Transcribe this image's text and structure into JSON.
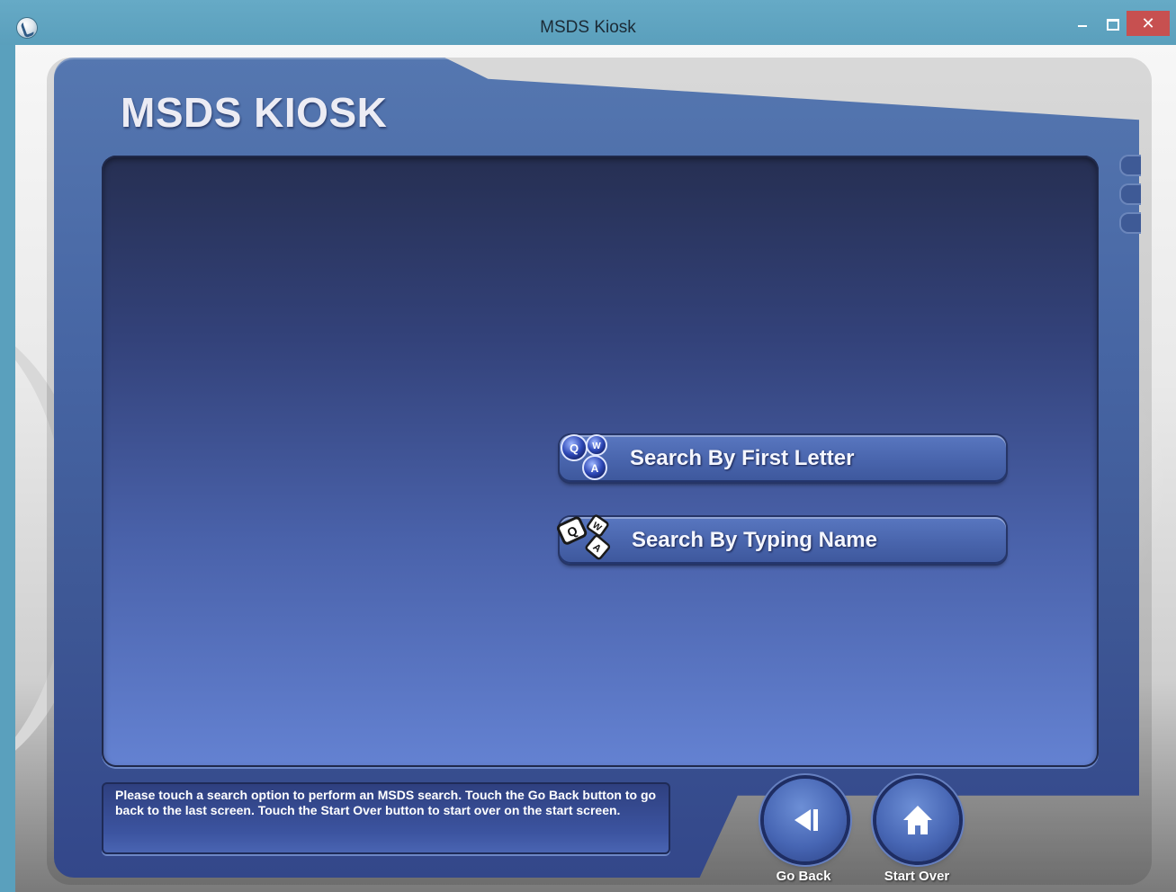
{
  "window": {
    "title": "MSDS Kiosk",
    "close_glyph": "✕"
  },
  "header": {
    "title": "MSDS KIOSK"
  },
  "search_options": [
    {
      "label": "Search By First Letter",
      "icon": "qwa-round-keys-icon"
    },
    {
      "label": "Search By Typing Name",
      "icon": "qwa-square-keys-icon"
    }
  ],
  "help": {
    "text": "Please touch a search option to perform an MSDS search. Touch the Go Back button to go back to the last screen. Touch the Start Over button to start over on the start screen."
  },
  "nav": {
    "go_back_label": "Go Back",
    "start_over_label": "Start Over"
  },
  "colors": {
    "titlebar": "#5aa0bd",
    "frame": "#4766a4",
    "panel_top": "#262f52",
    "panel_bottom": "#6482d2",
    "close_button": "#c75050"
  }
}
